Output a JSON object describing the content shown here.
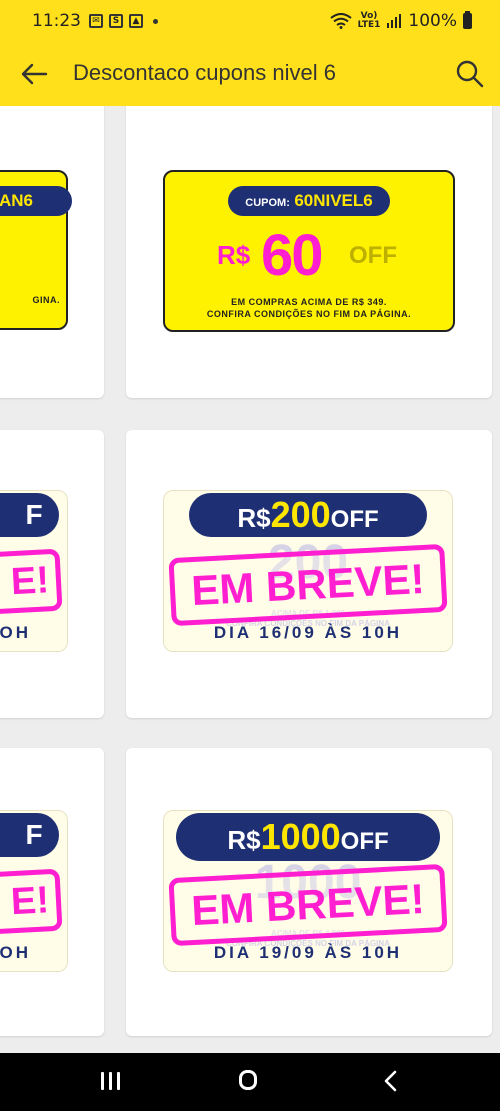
{
  "status_bar": {
    "time": "11:23",
    "battery": "100%",
    "lte_top": "Vo)",
    "lte_bottom": "LTE1"
  },
  "app_bar": {
    "title": "Descontaco cupons nivel 6"
  },
  "cards": [
    {
      "left_partial": {
        "code": "AN6",
        "lines": [
          "-",
          "GINA."
        ]
      },
      "main": {
        "coupon_label": "CUPOM:",
        "coupon_code": "60NIVEL6",
        "currency": "R$",
        "amount": "60",
        "off": "OFF",
        "line1": "EM COMPRAS ACIMA DE R$ 349.",
        "line2": "CONFIRA CONDIÇÕES NO FIM DA PÁGINA."
      }
    },
    {
      "left_partial": {
        "pill": "F",
        "breve": "E!",
        "dia": "OH"
      },
      "main": {
        "currency": "R$",
        "amount": "200",
        "off": "OFF",
        "breve": "EM BREVE!",
        "dia": "DIA 16/09 ÀS 10H",
        "ghost_line1": "ACIMA DE R$ 1.200",
        "ghost_line2": "CONFIRA CONDIÇÕES NO FIM DA PÁGINA"
      }
    },
    {
      "left_partial": {
        "pill": "F",
        "breve": "E!",
        "dia": "OH"
      },
      "main": {
        "currency": "R$",
        "amount": "1000",
        "off": "OFF",
        "breve": "EM BREVE!",
        "dia": "DIA 19/09 ÀS 10H",
        "ghost_line1": "ACIMA DE R$ 4.800",
        "ghost_line2": "CONFIRA CONDIÇÕES NO FIM DA PÁGINA"
      }
    }
  ],
  "colors": {
    "brand_yellow": "#ffe01b",
    "coupon_yellow": "#fff200",
    "navy": "#1e2f73",
    "magenta": "#ff1fd0",
    "gold": "#ffe600"
  },
  "icons": [
    "back-arrow-icon",
    "search-icon",
    "recent-apps-icon",
    "home-icon",
    "nav-back-icon"
  ]
}
